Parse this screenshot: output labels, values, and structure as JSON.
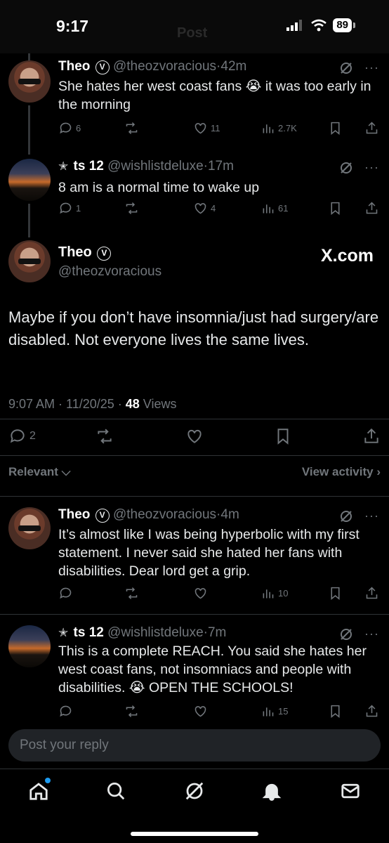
{
  "status_bar": {
    "time": "9:17",
    "battery": "89",
    "ghost_title": "Post"
  },
  "replies_top": [
    {
      "name": "Theo",
      "badge": "V",
      "handle": "@theozvoracious",
      "time": "42m",
      "star": "",
      "text": "She hates her west coast fans 😭 it was too early in the morning",
      "replies": "6",
      "reposts": "",
      "likes": "11",
      "views": "2.7K"
    },
    {
      "name": "ts 12",
      "badge": "",
      "handle": "@wishlistdeluxe",
      "time": "17m",
      "star": "✭",
      "text": "8 am is a normal time to wake up",
      "replies": "1",
      "reposts": "",
      "likes": "4",
      "views": "61"
    }
  ],
  "main_post": {
    "name": "Theo",
    "badge": "V",
    "handle": "@theozvoracious",
    "watermark": "X.com",
    "text": "Maybe if you don’t have insomnia/just had surgery/are disabled. Not everyone lives the same lives.",
    "meta_time": "9:07 AM · 11/20/25 · ",
    "views_count": "48",
    "views_label": " Views",
    "replies": "2"
  },
  "sort": {
    "label": "Relevant",
    "view_activity": "View activity"
  },
  "replies_bottom": [
    {
      "name": "Theo",
      "badge": "V",
      "handle": "@theozvoracious",
      "time": "4m",
      "star": "",
      "text": "It’s almost like I was being hyperbolic with my first statement. I never said she hated her fans with disabilities. Dear lord get a grip.",
      "replies": "",
      "reposts": "",
      "likes": "",
      "views": "10"
    },
    {
      "name": "ts 12",
      "badge": "",
      "handle": "@wishlistdeluxe",
      "time": "7m",
      "star": "✭",
      "text": "This is a complete REACH. You said she hates her west coast fans, not insomniacs and people with disabilities. 😭 OPEN THE SCHOOLS!",
      "replies": "",
      "reposts": "",
      "likes": "",
      "views": "15"
    }
  ],
  "composer": {
    "placeholder": "Post your reply"
  },
  "tabs": [
    "home-icon",
    "search-icon",
    "grok-icon",
    "notifications-icon",
    "messages-icon"
  ],
  "colors": {
    "background": "#000000",
    "muted": "#71767b",
    "accent": "#1d9bf0"
  }
}
